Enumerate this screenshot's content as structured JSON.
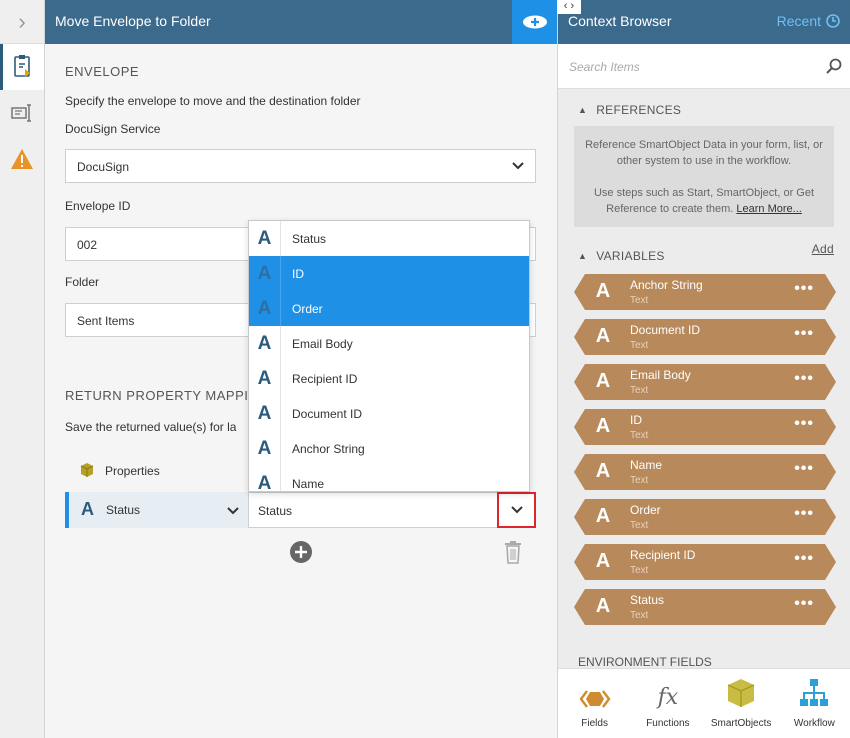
{
  "left_panel": {
    "title": "Move Envelope to Folder"
  },
  "envelope": {
    "section_title": "ENVELOPE",
    "description": "Specify the envelope to move and the destination folder",
    "service_label": "DocuSign Service",
    "service_value": "DocuSign",
    "envelope_id_label": "Envelope ID",
    "envelope_id_value": "002",
    "folder_label": "Folder",
    "folder_value": "Sent Items"
  },
  "return_mapping": {
    "section_title": "RETURN PROPERTY MAPPIN",
    "description": "Save the returned value(s) for la",
    "properties_label": "Properties",
    "row_label": "Status",
    "row_value": "Status"
  },
  "dropdown": {
    "options": [
      "Status",
      "ID",
      "Order",
      "Email Body",
      "Recipient ID",
      "Document ID",
      "Anchor String",
      "Name"
    ],
    "selected": [
      "ID",
      "Order"
    ]
  },
  "context_browser": {
    "title": "Context Browser",
    "recent_label": "Recent",
    "search_placeholder": "Search Items",
    "references_title": "REFERENCES",
    "references_text1": "Reference SmartObject Data in your form, list, or other system to use in the workflow.",
    "references_text2": "Use steps such as Start, SmartObject, or Get Reference to create them.",
    "learn_more": "Learn More...",
    "variables_title": "VARIABLES",
    "add_label": "Add",
    "variables": [
      {
        "name": "Anchor String",
        "type": "Text"
      },
      {
        "name": "Document ID",
        "type": "Text"
      },
      {
        "name": "Email Body",
        "type": "Text"
      },
      {
        "name": "ID",
        "type": "Text"
      },
      {
        "name": "Name",
        "type": "Text"
      },
      {
        "name": "Order",
        "type": "Text"
      },
      {
        "name": "Recipient ID",
        "type": "Text"
      },
      {
        "name": "Status",
        "type": "Text"
      }
    ],
    "environment_fields_title": "ENVIRONMENT FIELDS",
    "toolbar": [
      "Fields",
      "Functions",
      "SmartObjects",
      "Workflow"
    ]
  },
  "colors": {
    "header": "#3c6a8c",
    "accent": "#1e90e6",
    "variable": "#b8895a",
    "highlight": "#e0242b"
  }
}
